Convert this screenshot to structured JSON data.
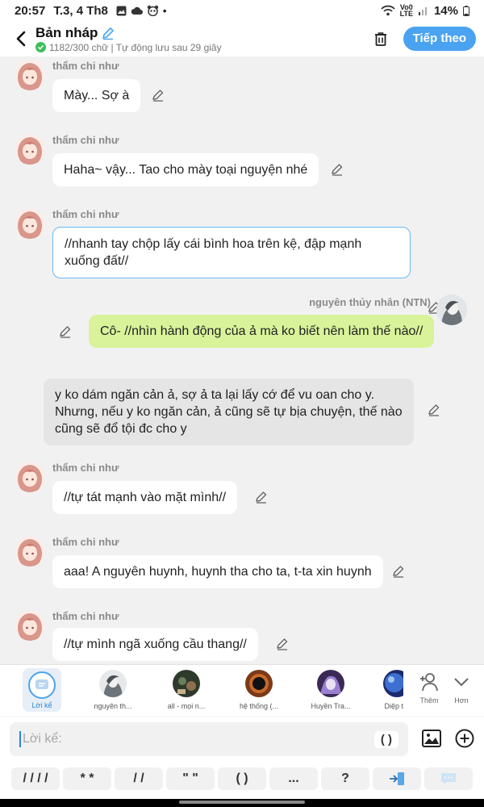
{
  "status_bar": {
    "time": "20:57",
    "date": "T.3, 4 Th8",
    "dot": "•",
    "lte_top": "Vo0",
    "lte_bottom": "LTE",
    "battery": "14%"
  },
  "header": {
    "title": "Bản nháp",
    "subtitle": "1182/300 chữ | Tự động lưu sau 29 giây",
    "next_label": "Tiếp theo"
  },
  "messages": [
    {
      "sender": "thẩm chi như",
      "text": "Mày... Sợ à"
    },
    {
      "sender": "thẩm chi như",
      "text": "Haha~ vậy... Tao cho mày toại nguyện nhé"
    },
    {
      "sender": "thẩm chi như",
      "text": "//nhanh tay chộp lấy cái bình hoa trên kệ, đập mạnh xuống đất//"
    },
    {
      "sender": "nguyên thủy nhân (NTN)",
      "text": "Cô- //nhìn hành động của ả mà ko biết nên làm thế nào//"
    },
    {
      "sender": "",
      "text": "y ko dám ngăn cản ả, sợ ả ta lại lấy cớ để vu oan cho y. Nhưng, nếu y ko ngăn cản, ả cũng sẽ tự bịa chuyện, thế nào cũng sẽ đổ tội đc cho y"
    },
    {
      "sender": "thẩm chi như",
      "text": "//tự tát mạnh vào mặt mình//"
    },
    {
      "sender": "thẩm chi như",
      "text": "aaa! A nguyên huynh, huynh tha cho ta, t-ta xin huynh"
    },
    {
      "sender": "thẩm chi như",
      "text": "//tự mình ngã xuống cầu thang//"
    }
  ],
  "character_bar": {
    "characters": [
      {
        "name": "Lời kể",
        "icon": "narration-icon"
      },
      {
        "name": "nguyên th...",
        "icon": "avatar-gray"
      },
      {
        "name": "all - mọi n...",
        "icon": "avatar-dark"
      },
      {
        "name": "hệ thống (...",
        "icon": "avatar-hole"
      },
      {
        "name": "Huyền Tra...",
        "icon": "avatar-purple"
      },
      {
        "name": "Diệp t",
        "icon": "avatar-blue"
      }
    ],
    "add_label": "Thêm",
    "more_label": "Hơn"
  },
  "input": {
    "placeholder": "Lời kể:",
    "paren_button": "( )"
  },
  "shortcuts": [
    "/ / / /",
    "* *",
    "/ /",
    "\" \"",
    "( )",
    "...",
    "?"
  ],
  "colors": {
    "accent": "#4aa3f0",
    "bubble_self": "#d8f39a",
    "bubble_narration": "#e5e5e6",
    "background": "#f1f1f2"
  }
}
